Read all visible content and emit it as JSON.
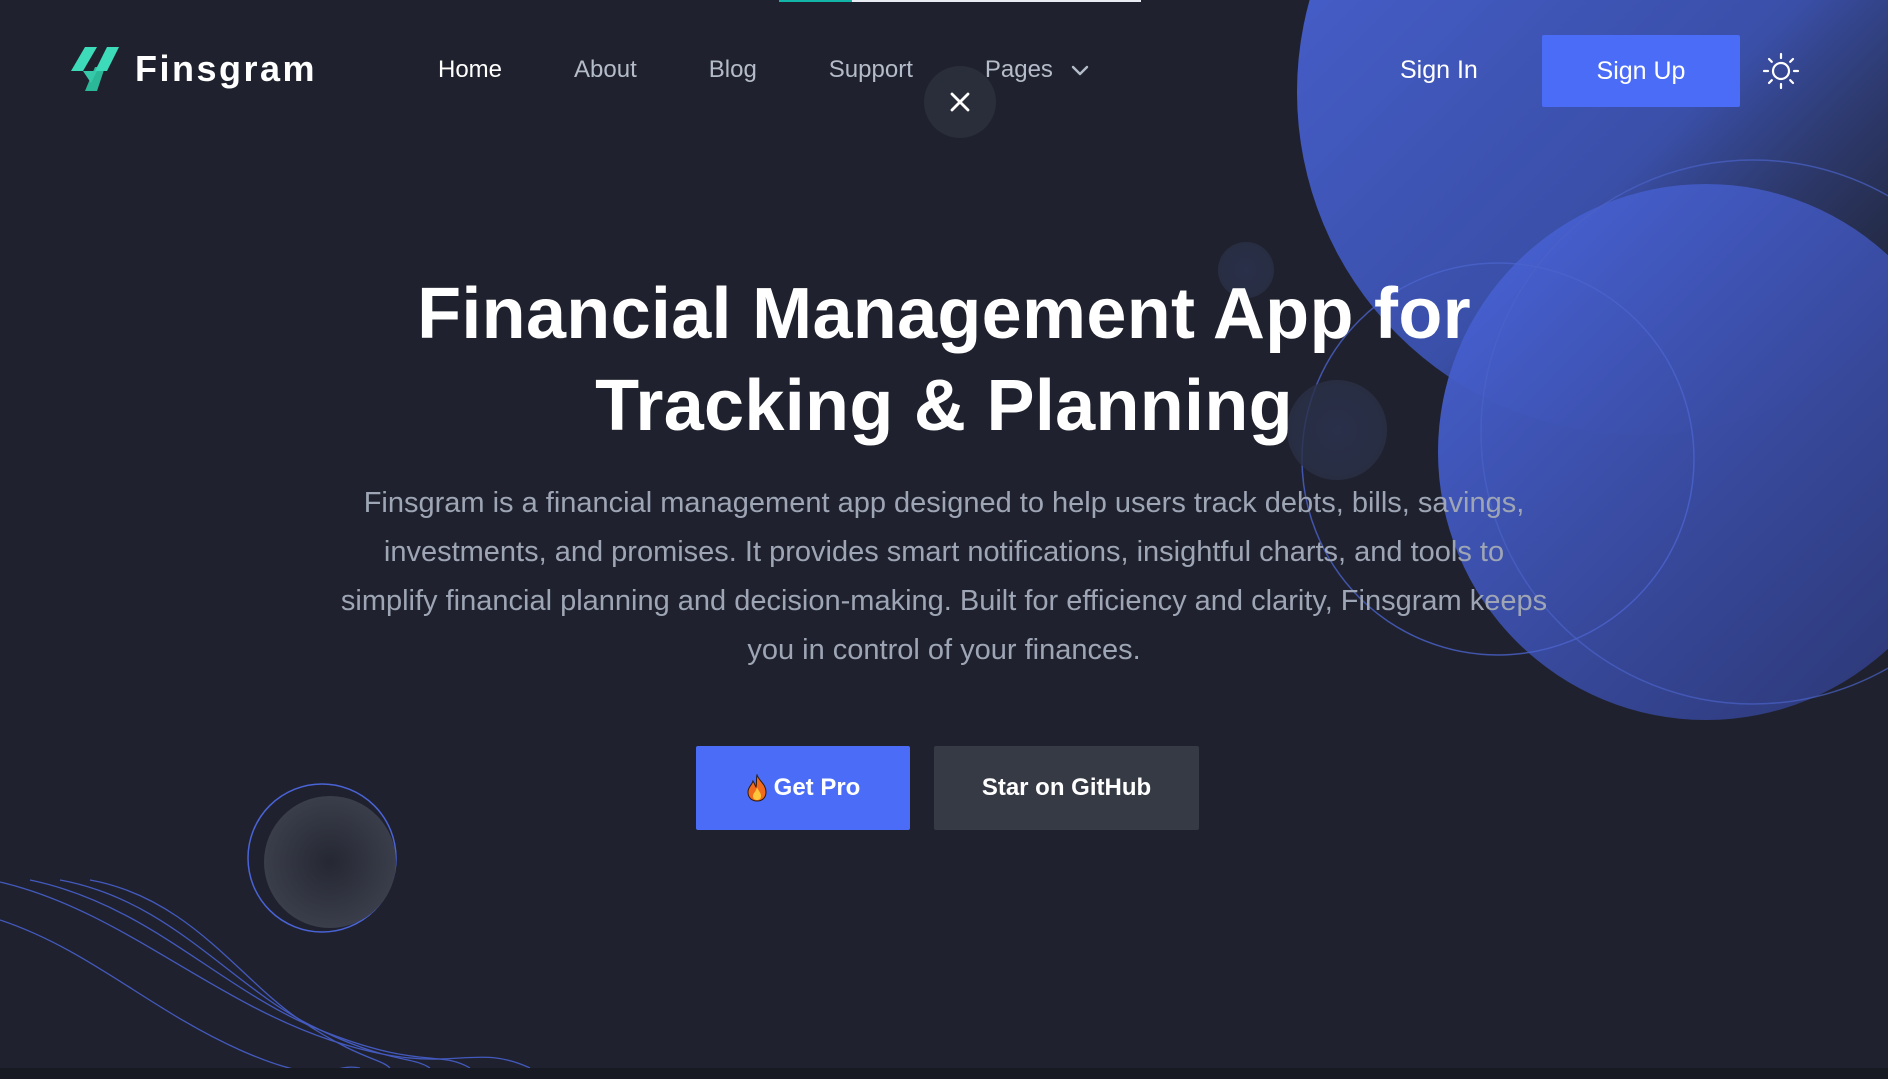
{
  "brand": {
    "name": "Finsgram",
    "icon": "finsgram-logo-icon"
  },
  "nav": {
    "items": [
      {
        "label": "Home",
        "active": true
      },
      {
        "label": "About",
        "active": false
      },
      {
        "label": "Blog",
        "active": false
      },
      {
        "label": "Support",
        "active": false
      }
    ],
    "pages_label": "Pages",
    "pages_icon": "chevron-down-icon",
    "close_icon": "close-icon"
  },
  "auth": {
    "signin_label": "Sign In",
    "signup_label": "Sign Up",
    "theme_icon": "sun-icon"
  },
  "hero": {
    "title_line1": "Financial Management App for",
    "title_line2": "Tracking & Planning",
    "description": "Finsgram is a financial management app designed to help users track debts, bills, savings, investments, and promises. It provides smart notifications, insightful charts, and tools to simplify financial planning and decision-making. Built for efficiency and clarity, Finsgram keeps you in control of your finances.",
    "primary_button": "Get Pro",
    "primary_icon": "fire-icon",
    "secondary_button": "Star on GitHub"
  },
  "colors": {
    "background": "#1f222e",
    "accent": "#4a6cf7",
    "logo": "#3ddbb9",
    "muted_text": "#9ea5b5",
    "secondary_button": "#363a45"
  }
}
